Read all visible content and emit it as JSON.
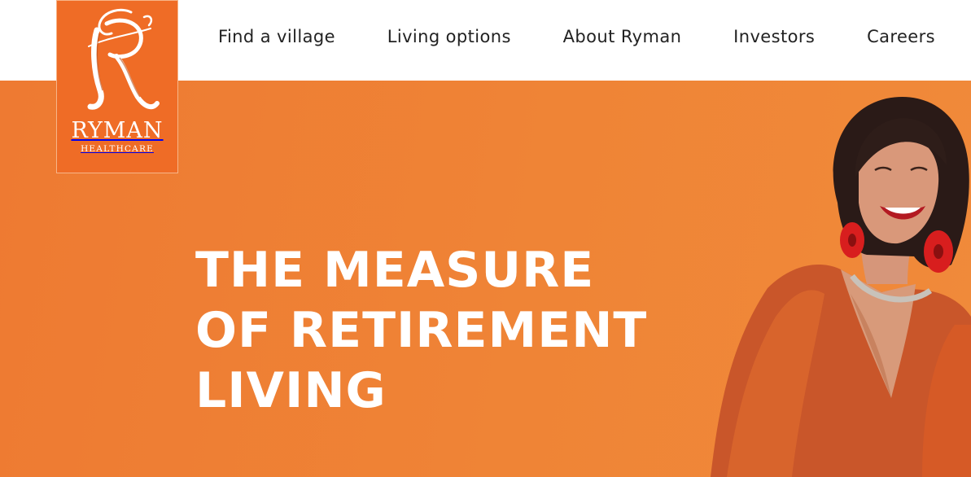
{
  "logo": {
    "brand": "RYMAN",
    "sub": "HEALTHCARE"
  },
  "nav": {
    "items": [
      "Find a village",
      "Living options",
      "About Ryman",
      "Investors",
      "Careers"
    ]
  },
  "hero": {
    "headline_lines": [
      "THE MEASURE",
      "OF RETIREMENT",
      "LIVING"
    ]
  },
  "colors": {
    "brand_orange": "#ef6c26",
    "hero_orange": "#ee7a32",
    "nav_text": "#222222"
  }
}
